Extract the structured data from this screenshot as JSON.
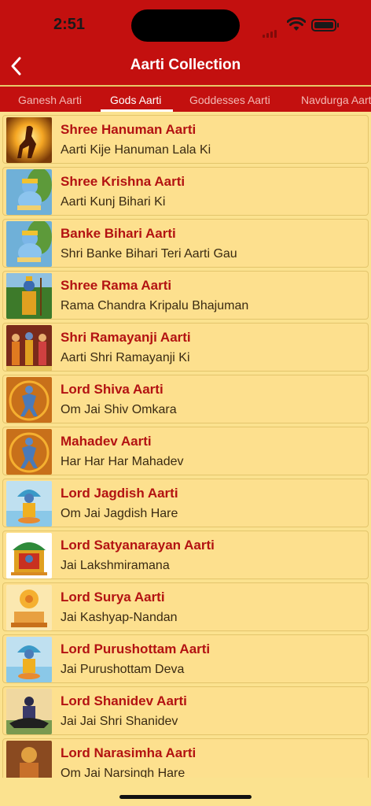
{
  "status_bar": {
    "time": "2:51"
  },
  "nav": {
    "title": "Aarti Collection"
  },
  "tabs": [
    {
      "label": "Ganesh Aarti",
      "active": false
    },
    {
      "label": "Gods Aarti",
      "active": true
    },
    {
      "label": "Goddesses Aarti",
      "active": false
    },
    {
      "label": "Navdurga Aarti",
      "active": false
    }
  ],
  "items": [
    {
      "title": "Shree Hanuman Aarti",
      "subtitle": "Aarti Kije Hanuman Lala Ki",
      "icon": "hanuman-icon"
    },
    {
      "title": "Shree Krishna Aarti",
      "subtitle": "Aarti Kunj Bihari Ki",
      "icon": "krishna-icon"
    },
    {
      "title": "Banke Bihari Aarti",
      "subtitle": "Shri Banke Bihari Teri Aarti Gau",
      "icon": "krishna-icon"
    },
    {
      "title": "Shree Rama Aarti",
      "subtitle": "Rama Chandra Kripalu Bhajuman",
      "icon": "rama-icon"
    },
    {
      "title": "Shri Ramayanji Aarti",
      "subtitle": "Aarti Shri Ramayanji Ki",
      "icon": "ram-darbar-icon"
    },
    {
      "title": "Lord Shiva Aarti",
      "subtitle": "Om Jai Shiv Omkara",
      "icon": "shiva-icon"
    },
    {
      "title": "Mahadev Aarti",
      "subtitle": "Har Har Har Mahadev",
      "icon": "shiva-icon"
    },
    {
      "title": "Lord Jagdish Aarti",
      "subtitle": "Om Jai Jagdish Hare",
      "icon": "vishnu-icon"
    },
    {
      "title": "Lord Satyanarayan Aarti",
      "subtitle": "Jai Lakshmiramana",
      "icon": "satyanarayan-icon"
    },
    {
      "title": "Lord Surya Aarti",
      "subtitle": "Jai Kashyap-Nandan",
      "icon": "surya-icon"
    },
    {
      "title": "Lord Purushottam Aarti",
      "subtitle": "Jai Purushottam Deva",
      "icon": "vishnu-icon"
    },
    {
      "title": "Lord Shanidev Aarti",
      "subtitle": "Jai Jai Shri Shanidev",
      "icon": "shanidev-icon"
    },
    {
      "title": "Lord Narasimha Aarti",
      "subtitle": "Om Jai Narsingh Hare",
      "icon": "narasimha-icon"
    }
  ],
  "colors": {
    "header_red": "#c3100f",
    "list_background": "#fbe28f",
    "title_red": "#b31212",
    "subtitle_brown": "#3a2a12"
  }
}
